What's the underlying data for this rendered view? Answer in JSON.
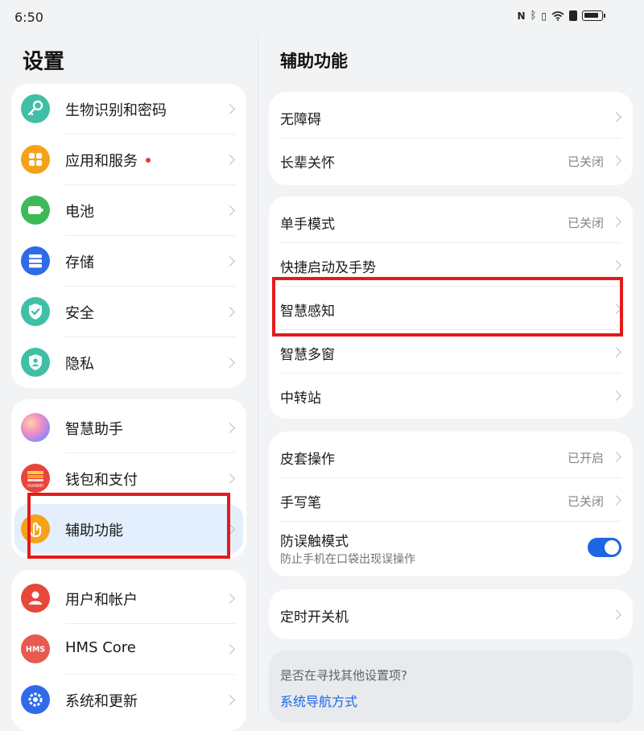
{
  "status_bar": {
    "time": "6:50",
    "icons": [
      "nfc-icon",
      "bluetooth-icon",
      "vibrate-icon",
      "wifi-icon",
      "battery-saver-icon",
      "battery-icon"
    ]
  },
  "left_panel": {
    "title": "设置",
    "groups": [
      {
        "items": [
          {
            "label": "生物识别和密码",
            "icon": "key-icon",
            "color": "#3fbfa6"
          },
          {
            "label": "应用和服务",
            "icon": "apps-icon",
            "color": "#f5a21b",
            "badge": true
          },
          {
            "label": "电池",
            "icon": "battery-icon",
            "color": "#3dba57"
          },
          {
            "label": "存储",
            "icon": "storage-icon",
            "color": "#2f6ae8"
          },
          {
            "label": "安全",
            "icon": "shield-check-icon",
            "color": "#3fbfa6"
          },
          {
            "label": "隐私",
            "icon": "privacy-shield-icon",
            "color": "#3fbfa6"
          }
        ]
      },
      {
        "items": [
          {
            "label": "智慧助手",
            "icon": "assistant-orb-icon",
            "color": "#b98cf5"
          },
          {
            "label": "钱包和支付",
            "icon": "wallet-icon",
            "color": "#e8433c",
            "icon_text": "HUAWEI"
          },
          {
            "label": "辅助功能",
            "icon": "hand-pointer-icon",
            "color": "#f5a21b",
            "selected": true
          }
        ]
      },
      {
        "items": [
          {
            "label": "用户和帐户",
            "icon": "user-icon",
            "color": "#e8473c"
          },
          {
            "label": "HMS Core",
            "icon": "hms-icon",
            "color": "#e85a4f",
            "icon_text": "HMS"
          },
          {
            "label": "系统和更新",
            "icon": "gear-icon",
            "color": "#2f6ae8"
          }
        ]
      }
    ]
  },
  "right_panel": {
    "title": "辅助功能",
    "groups": [
      {
        "items": [
          {
            "label": "无障碍"
          },
          {
            "label": "长辈关怀",
            "value": "已关闭"
          }
        ]
      },
      {
        "items": [
          {
            "label": "单手模式",
            "value": "已关闭"
          },
          {
            "label": "快捷启动及手势"
          },
          {
            "label": "智慧感知"
          },
          {
            "label": "智慧多窗"
          },
          {
            "label": "中转站"
          }
        ]
      },
      {
        "items": [
          {
            "label": "皮套操作",
            "value": "已开启"
          },
          {
            "label": "手写笔",
            "value": "已关闭"
          },
          {
            "label": "防误触模式",
            "sublabel": "防止手机在口袋出现误操作",
            "toggle_on": true
          }
        ]
      },
      {
        "items": [
          {
            "label": "定时开关机"
          }
        ]
      }
    ],
    "suggestion": {
      "question": "是否在寻找其他设置项?",
      "link": "系统导航方式"
    }
  },
  "accent_color": "#1d66e5",
  "highlight_color": "#e41b1b"
}
